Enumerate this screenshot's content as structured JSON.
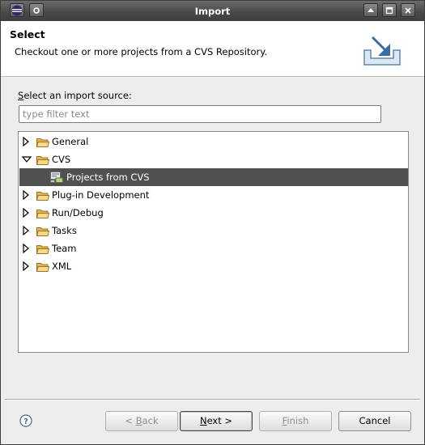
{
  "window": {
    "title": "Import"
  },
  "header": {
    "title": "Select",
    "description": "Checkout one or more projects from a CVS Repository."
  },
  "source": {
    "label_mnemonic": "S",
    "label_rest": "elect an import source:",
    "filter_placeholder": "type filter text"
  },
  "tree": {
    "items": [
      {
        "label": "General",
        "expanded": false,
        "level": 0
      },
      {
        "label": "CVS",
        "expanded": true,
        "level": 0
      },
      {
        "label": "Projects from CVS",
        "level": 1,
        "selected": true,
        "icon": "cvs-projects-icon"
      },
      {
        "label": "Plug-in Development",
        "expanded": false,
        "level": 0
      },
      {
        "label": "Run/Debug",
        "expanded": false,
        "level": 0
      },
      {
        "label": "Tasks",
        "expanded": false,
        "level": 0
      },
      {
        "label": "Team",
        "expanded": false,
        "level": 0
      },
      {
        "label": "XML",
        "expanded": false,
        "level": 0
      }
    ]
  },
  "buttons": {
    "back_prefix": "< ",
    "back_mnemonic": "B",
    "back_rest": "ack",
    "next_mnemonic": "N",
    "next_rest": "ext >",
    "finish_mnemonic": "F",
    "finish_rest": "inish",
    "cancel": "Cancel"
  },
  "colors": {
    "selection": "#505050",
    "titlebar": "#4a4a4a",
    "folder": "#e8b54a"
  }
}
